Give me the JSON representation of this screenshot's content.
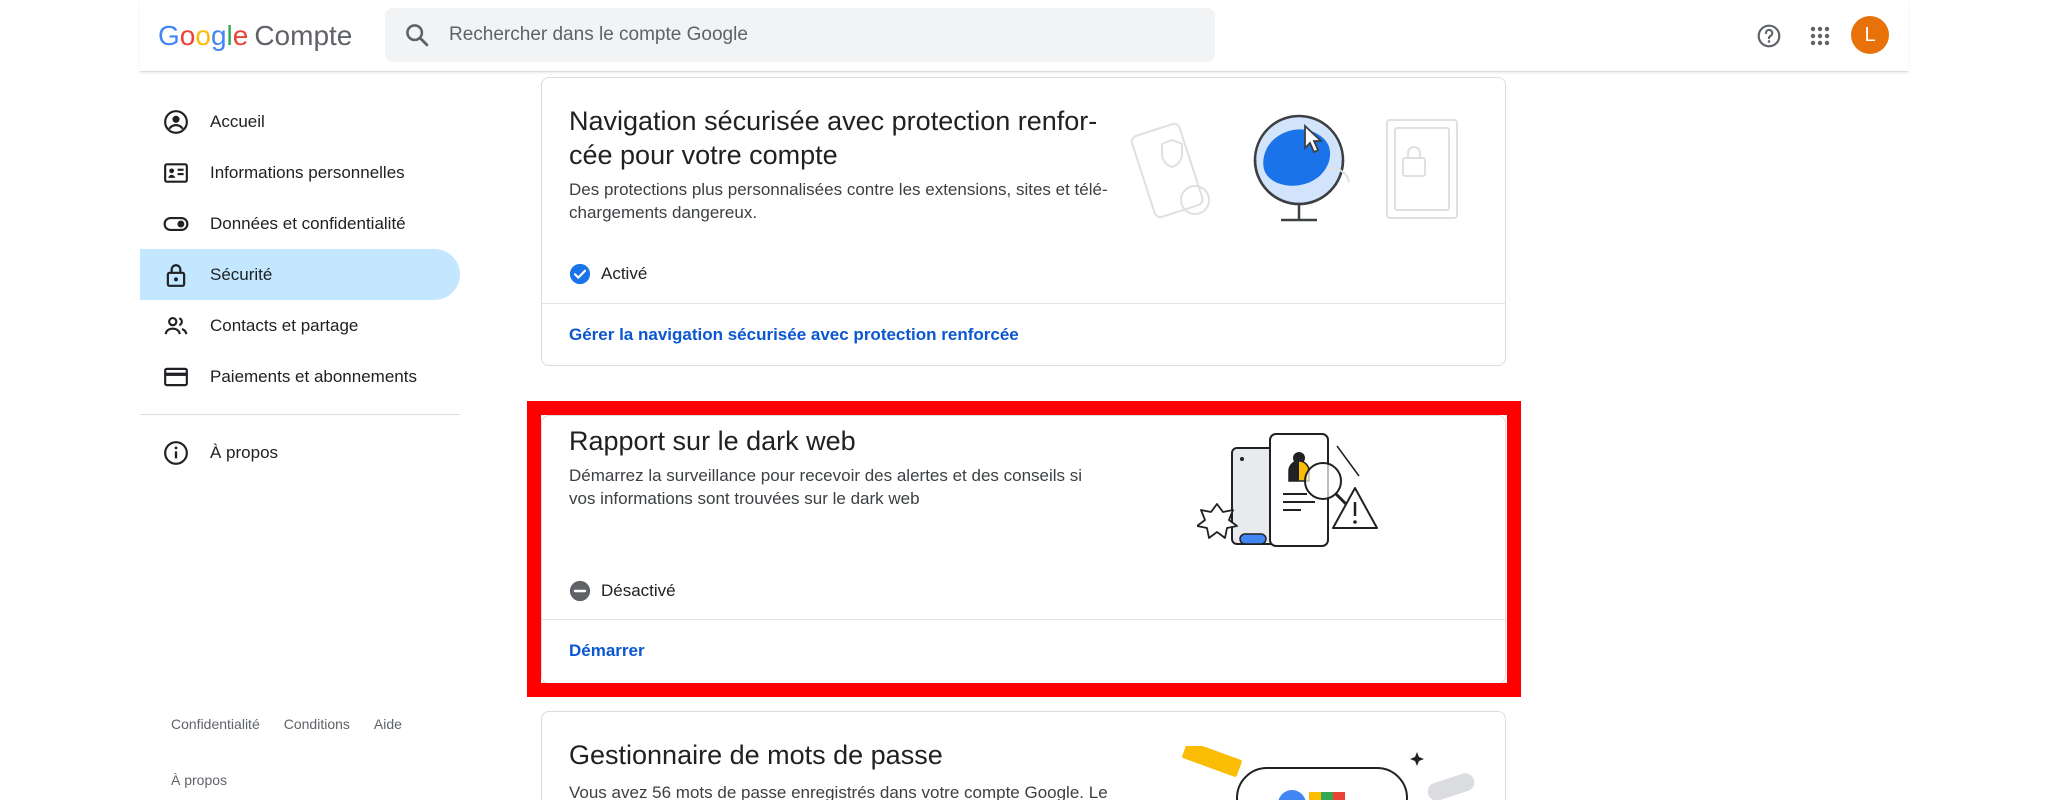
{
  "header": {
    "logo_letters": [
      "G",
      "o",
      "o",
      "g",
      "l",
      "e"
    ],
    "product": "Compte",
    "search_placeholder": "Rechercher dans le compte Google",
    "help_icon": "help-circle-icon",
    "apps_icon": "apps-grid-icon",
    "avatar_initial": "L",
    "avatar_color": "#e8710a"
  },
  "sidebar": {
    "items": [
      {
        "label": "Accueil",
        "icon": "account-circle-icon"
      },
      {
        "label": "Informations personnelles",
        "icon": "id-card-icon"
      },
      {
        "label": "Données et confidentialité",
        "icon": "toggle-icon"
      },
      {
        "label": "Sécurité",
        "icon": "lock-icon",
        "active": true
      },
      {
        "label": "Contacts et partage",
        "icon": "people-icon"
      },
      {
        "label": "Paiements et abonnements",
        "icon": "credit-card-icon"
      }
    ],
    "about": {
      "label": "À propos",
      "icon": "info-icon"
    },
    "footer_links": [
      "Confidentialité",
      "Conditions",
      "Aide"
    ],
    "footer_about": "À propos",
    "active_color": "#c2e7ff"
  },
  "cards": [
    {
      "title": "Navigation sécurisée avec protection renfor-cée pour votre compte",
      "description": "Des protections plus personnalisées contre les extensions, sites et télé-chargements dangereux.",
      "status": "Activé",
      "status_icon": "check-circle-icon",
      "link": "Gérer la navigation sécurisée avec protection renforcée"
    },
    {
      "title": "Rapport sur le dark web",
      "description": "Démarrez la surveillance pour recevoir des alertes et des conseils si vos informations sont trouvées sur le dark web",
      "status": "Désactivé",
      "status_icon": "minus-circle-icon",
      "link": "Démarrer",
      "highlighted": true
    },
    {
      "title": "Gestionnaire de mots de passe",
      "description": "Vous avez 56 mots de passe enregistrés dans votre compte Google. Le"
    }
  ],
  "colors": {
    "link": "#0b57d0",
    "check": "#1a73e8",
    "highlight_border": "#ff0000"
  }
}
